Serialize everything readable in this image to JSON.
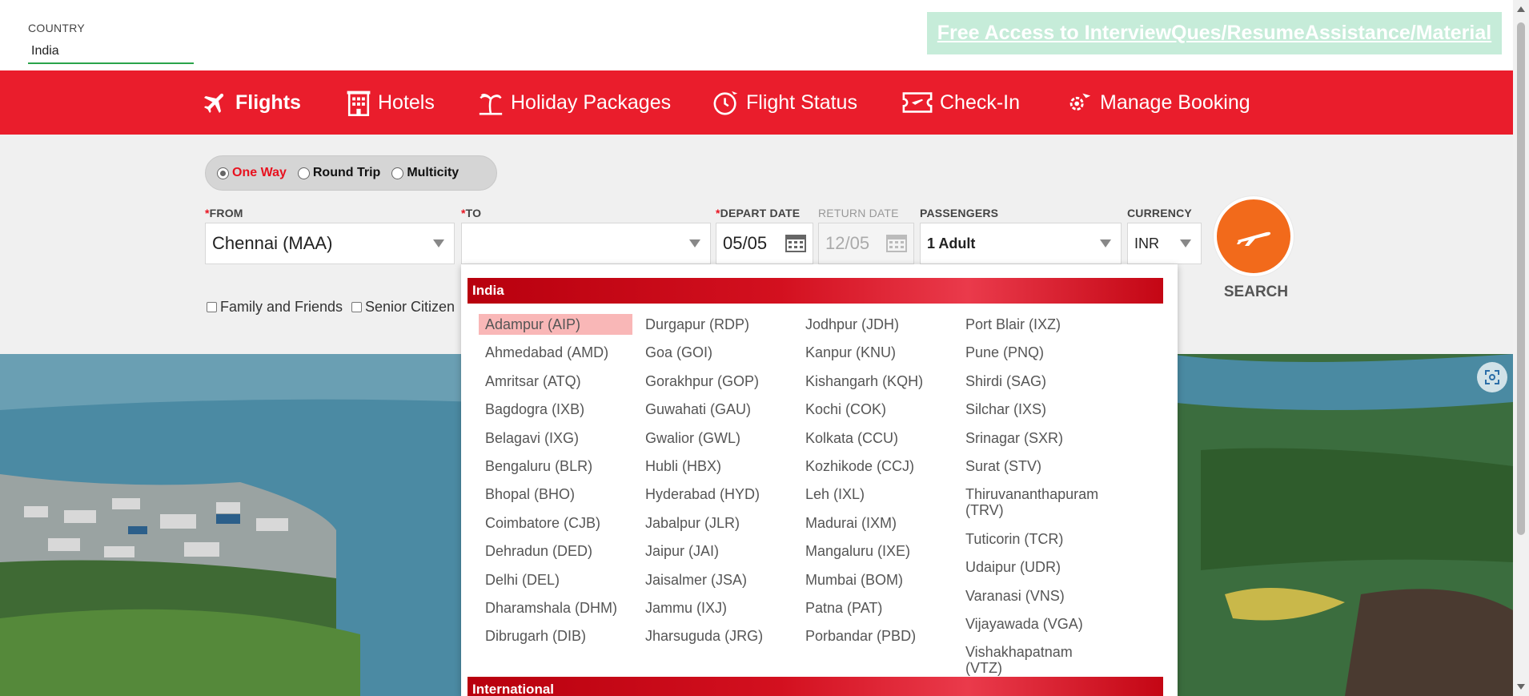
{
  "header": {
    "country_label": "COUNTRY",
    "country_value": "India",
    "promo_text": "Free Access to InterviewQues/ResumeAssistance/Material"
  },
  "nav": {
    "items": [
      {
        "label": "Flights",
        "icon": "plane-icon",
        "active": true
      },
      {
        "label": "Hotels",
        "icon": "hotel-icon",
        "active": false
      },
      {
        "label": "Holiday Packages",
        "icon": "palm-tree-icon",
        "active": false
      },
      {
        "label": "Flight Status",
        "icon": "clock-plane-icon",
        "active": false
      },
      {
        "label": "Check-In",
        "icon": "ticket-icon",
        "active": false
      },
      {
        "label": "Manage Booking",
        "icon": "gear-plane-icon",
        "active": false
      }
    ]
  },
  "trip_type": {
    "options": [
      {
        "label": "One Way",
        "selected": true
      },
      {
        "label": "Round Trip",
        "selected": false
      },
      {
        "label": "Multicity",
        "selected": false
      }
    ]
  },
  "form": {
    "from_label": "FROM",
    "from_value": "Chennai (MAA)",
    "to_label": "TO",
    "to_value": "",
    "depart_label": "DEPART DATE",
    "depart_value": "05/05",
    "return_label": "RETURN DATE",
    "return_value": "12/05",
    "passengers_label": "PASSENGERS",
    "passengers_value": "1 Adult",
    "currency_label": "CURRENCY",
    "currency_value": "INR",
    "search_label": "SEARCH",
    "family_friends": "Family and Friends",
    "senior_citizen": "Senior Citizen"
  },
  "dropdown": {
    "group_india": "India",
    "group_international": "International",
    "columns": [
      [
        "Adampur (AIP)",
        "Ahmedabad (AMD)",
        "Amritsar (ATQ)",
        "Bagdogra (IXB)",
        "Belagavi (IXG)",
        "Bengaluru (BLR)",
        "Bhopal (BHO)",
        "Coimbatore (CJB)",
        "Dehradun (DED)",
        "Delhi (DEL)",
        "Dharamshala (DHM)",
        "Dibrugarh (DIB)"
      ],
      [
        "Durgapur (RDP)",
        "Goa (GOI)",
        "Gorakhpur (GOP)",
        "Guwahati (GAU)",
        "Gwalior (GWL)",
        "Hubli (HBX)",
        "Hyderabad (HYD)",
        "Jabalpur (JLR)",
        "Jaipur (JAI)",
        "Jaisalmer (JSA)",
        "Jammu (IXJ)",
        "Jharsuguda (JRG)"
      ],
      [
        "Jodhpur (JDH)",
        "Kanpur (KNU)",
        "Kishangarh (KQH)",
        "Kochi (COK)",
        "Kolkata (CCU)",
        "Kozhikode (CCJ)",
        "Leh (IXL)",
        "Madurai (IXM)",
        "Mangaluru (IXE)",
        "Mumbai (BOM)",
        "Patna (PAT)",
        "Porbandar (PBD)"
      ],
      [
        "Port Blair (IXZ)",
        "Pune (PNQ)",
        "Shirdi (SAG)",
        "Silchar (IXS)",
        "Srinagar (SXR)",
        "Surat (STV)",
        "Thiruvananthapuram (TRV)",
        "Tuticorin (TCR)",
        "Udaipur (UDR)",
        "Varanasi (VNS)",
        "Vijayawada (VGA)",
        "Vishakhapatnam (VTZ)"
      ]
    ],
    "highlighted": "Adampur (AIP)"
  },
  "colors": {
    "brand_red": "#ea1d2c",
    "search_orange": "#f26a1b",
    "highlight": "#f9b7b7"
  }
}
